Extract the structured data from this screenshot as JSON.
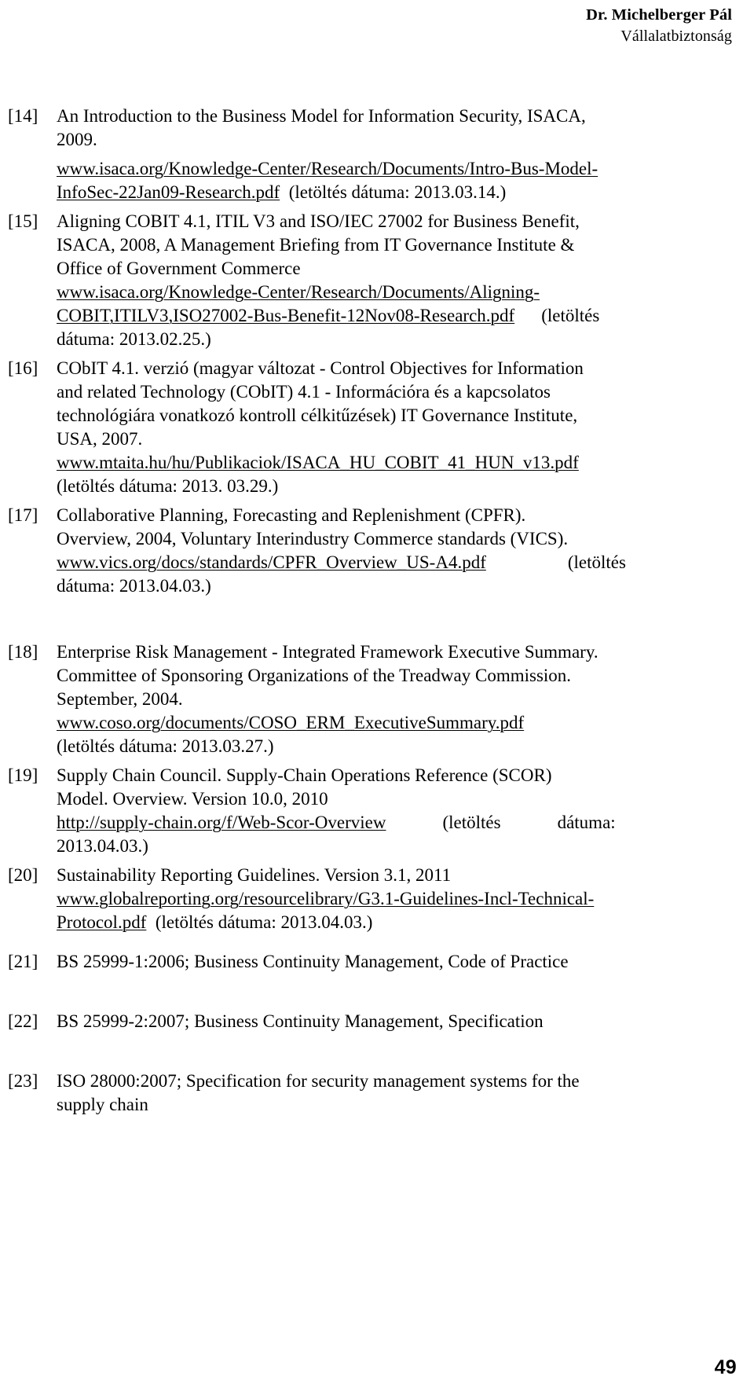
{
  "header": {
    "author": "Dr. Michelberger Pál",
    "subtitle": "Vállalatbiztonság"
  },
  "footer": {
    "page_number": "49"
  },
  "references": [
    {
      "tag": "[14]",
      "line1": "An Introduction to the Business Model for Information Security, ISACA,",
      "line2": "2009.",
      "url1": "www.isaca.org/Knowledge-Center/Research/Documents/Intro-Bus-Model-",
      "url2": "InfoSec-22Jan09-Research.pdf",
      "access": "(letöltés dátuma: 2013.03.14.)"
    },
    {
      "tag": "[15]",
      "line1": "Aligning COBIT 4.1, ITIL V3 and ISO/IEC 27002 for Business Benefit,",
      "line2": "ISACA, 2008, A Management Briefing from IT Governance Institute &",
      "line3": "Office of Government Commerce",
      "url1": "www.isaca.org/Knowledge-Center/Research/Documents/Aligning-",
      "url2": "COBIT,ITILV3,ISO27002-Bus-Benefit-12Nov08-Research.pdf",
      "access1": "(letöltés",
      "access2": "dátuma: 2013.02.25.)"
    },
    {
      "tag": "[16]",
      "line1": "CObIT 4.1. verzió (magyar változat - Control Objectives for Information",
      "line2": "and related Technology (CObIT) 4.1 - Információra és a kapcsolatos",
      "line3": "technológiára vonatkozó kontroll célkitűzések) IT Governance Institute,",
      "line4": "USA, 2007.",
      "url1": "www.mtaita.hu/hu/Publikaciok/ISACA_HU_COBIT_41_HUN_v13.pdf",
      "access": "(letöltés dátuma: 2013. 03.29.)"
    },
    {
      "tag": "[17]",
      "line1": "Collaborative Planning, Forecasting and Replenishment (CPFR).",
      "line2": "Overview, 2004, Voluntary Interindustry Commerce standards (VICS).",
      "url1": "www.vics.org/docs/standards/CPFR_Overview_US-A4.pdf",
      "access1": "(letöltés",
      "access2": "dátuma: 2013.04.03.)"
    },
    {
      "tag": "[18]",
      "line1": "Enterprise Risk Management - Integrated Framework Executive Summary.",
      "line2": "Committee of Sponsoring Organizations of the Treadway Commission.",
      "line3": "September, 2004.",
      "url1": "www.coso.org/documents/COSO_ERM_ExecutiveSummary.pdf",
      "access": "(letöltés dátuma: 2013.03.27.)"
    },
    {
      "tag": "[19]",
      "line1": "Supply Chain Council. Supply-Chain Operations Reference (SCOR)",
      "line2": "Model. Overview. Version 10.0, 2010",
      "url1": "http://supply-chain.org/f/Web-Scor-Overview",
      "access1": "(letöltés",
      "access2": "dátuma:",
      "access3": "2013.04.03.)"
    },
    {
      "tag": "[20]",
      "line1": "Sustainability Reporting Guidelines. Version 3.1, 2011",
      "url1": "www.globalreporting.org/resourcelibrary/G3.1-Guidelines-Incl-Technical-",
      "url2": "Protocol.pdf",
      "access": "(letöltés dátuma: 2013.04.03.)"
    },
    {
      "tag": "[21]",
      "line1": "BS 25999-1:2006;  Business Continuity Management, Code of Practice"
    },
    {
      "tag": "[22]",
      "line1": "BS 25999-2:2007; Business Continuity Management, Specification"
    },
    {
      "tag": "[23]",
      "line1": "ISO 28000:2007; Specification for security management systems for the",
      "line2": "supply chain"
    }
  ]
}
